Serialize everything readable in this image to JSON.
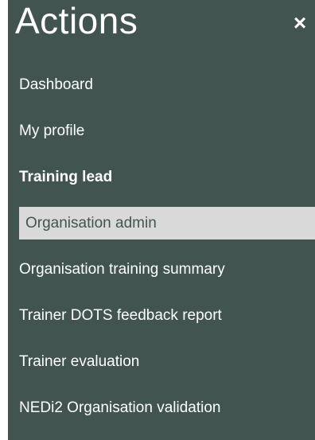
{
  "panel": {
    "title": "Actions",
    "close_glyph": "×",
    "close_icon": "close-icon"
  },
  "menu": {
    "items": [
      {
        "label": "Dashboard"
      },
      {
        "label": "My profile"
      },
      {
        "label": "Training lead"
      },
      {
        "label": "Organisation admin"
      },
      {
        "label": "Organisation training summary"
      },
      {
        "label": "Trainer DOTS feedback report"
      },
      {
        "label": "Trainer evaluation"
      },
      {
        "label": "NEDi2 Organisation validation"
      }
    ]
  },
  "colors": {
    "panel_bg": "#425450",
    "text": "#ffffff",
    "active_bg": "#d9d9d9",
    "active_text": "#425450"
  }
}
